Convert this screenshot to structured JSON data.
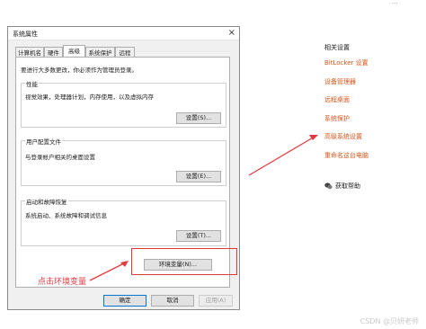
{
  "dialog": {
    "title": "系统属性",
    "close_glyph": "×",
    "tabs": [
      {
        "label": "计算机名"
      },
      {
        "label": "硬件"
      },
      {
        "label": "高级"
      },
      {
        "label": "系统保护"
      },
      {
        "label": "远程"
      }
    ],
    "admin_note": "要进行大多数更改，你必须作为管理员登录。",
    "performance": {
      "title": "性能",
      "description": "视觉效果，处理器计划，内存使用，以及虚拟内存",
      "button": "设置(S)..."
    },
    "user_profiles": {
      "title": "用户配置文件",
      "description": "与登录帐户相关的桌面设置",
      "button": "设置(E)..."
    },
    "startup_recovery": {
      "title": "启动和故障恢复",
      "description": "系统启动、系统故障和调试信息",
      "button": "设置(T)..."
    },
    "env_button": "环境变量(N)...",
    "ok": "确定",
    "cancel": "取消",
    "apply": "应用(A)"
  },
  "related": {
    "heading": "相关设置",
    "links": [
      "BitLocker 设置",
      "设备管理器",
      "远程桌面",
      "系统保护",
      "高级系统设置",
      "重命名这台电脑"
    ],
    "help": "获取帮助"
  },
  "annotation": "点击环境变量",
  "watermark": "CSDN @贝妍老师",
  "corner": "···",
  "colors": {
    "link": "#d4541a",
    "annotation": "#e0393e",
    "accent": "#0078d7"
  }
}
